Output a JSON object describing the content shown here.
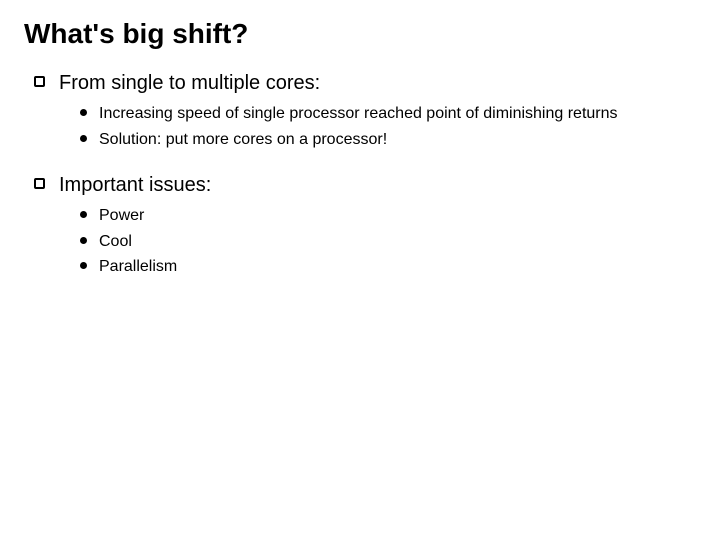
{
  "title": "What's big shift?",
  "items": [
    {
      "label": "From single to multiple cores:",
      "sub": [
        "Increasing speed of single processor reached point of diminishing returns",
        "Solution: put more cores on a processor!"
      ]
    },
    {
      "label": "Important issues:",
      "sub": [
        "Power",
        "Cool",
        "Parallelism"
      ]
    }
  ]
}
